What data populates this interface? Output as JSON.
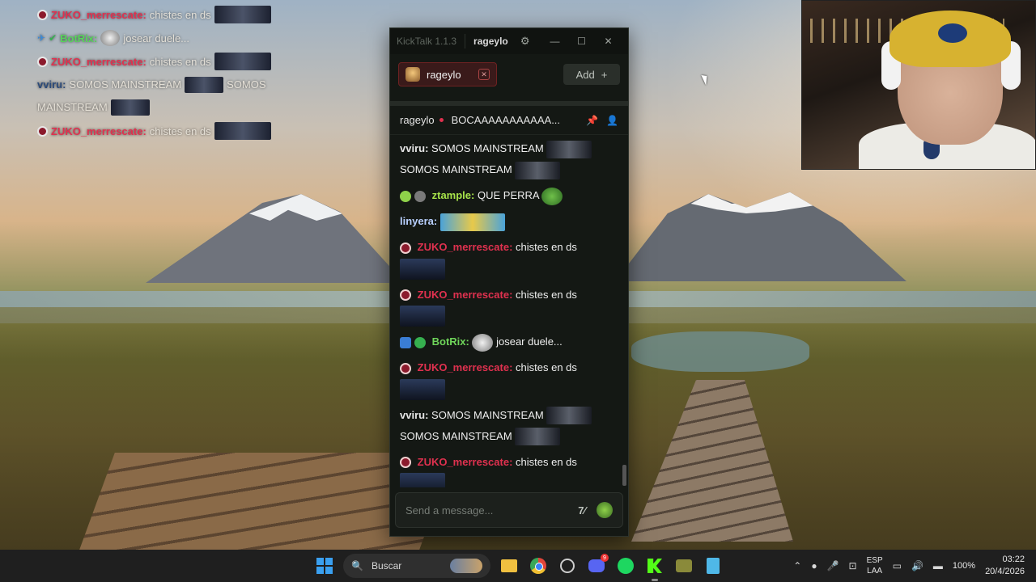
{
  "overlay": {
    "lines": [
      {
        "user": "ZUKO_merrescate:",
        "msg": "chistes en ds"
      },
      {
        "user": "BotRix:",
        "msg": "josear duele..."
      },
      {
        "user": "ZUKO_merrescate:",
        "msg": "chistes en ds"
      },
      {
        "user": "vviru:",
        "msg": "SOMOS MAINSTREAM",
        "msg2": "SOMOS",
        "msg3": "MAINSTREAM"
      },
      {
        "user": "ZUKO_merrescate:",
        "msg": "chistes en ds"
      }
    ]
  },
  "kicktalk": {
    "app_title": "KickTalk 1.1.3",
    "current_user": "rageylo",
    "tab": {
      "label": "rageylo"
    },
    "add_label": "Add",
    "add_icon": "+",
    "channel": "rageylo",
    "stream_title": "BOCAAAAAAAAAAA...",
    "messages": [
      {
        "user": "vviru:",
        "text": "SOMOS MAINSTREAM",
        "text2": "SOMOS MAINSTREAM"
      },
      {
        "user": "ztample:",
        "text": "QUE PERRA"
      },
      {
        "user": "linyera:",
        "text": ""
      },
      {
        "user": "ZUKO_merrescate:",
        "text": "chistes en ds"
      },
      {
        "user": "ZUKO_merrescate:",
        "text": "chistes en ds"
      },
      {
        "user": "BotRix:",
        "text": "josear duele..."
      },
      {
        "user": "ZUKO_merrescate:",
        "text": "chistes en ds"
      },
      {
        "user": "vviru:",
        "text": "SOMOS MAINSTREAM",
        "text2": "SOMOS MAINSTREAM"
      },
      {
        "user": "ZUKO_merrescate:",
        "text": "chistes en ds"
      }
    ],
    "input_placeholder": "Send a message...",
    "translate_icon": "7⁄",
    "colors": {
      "bg": "#141814",
      "tab_border": "#6e2222",
      "user_red": "#e0314f",
      "user_green": "#6fd55a"
    }
  },
  "taskbar": {
    "search_label": "Buscar",
    "discord_badge": "9",
    "lang_line1": "ESP",
    "lang_line2": "LAA",
    "battery": "100%",
    "time": "03:22",
    "date": "20/4/2026"
  },
  "icons": [
    "windows-icon",
    "search-icon",
    "folder-icon",
    "chrome-icon",
    "discord-icon",
    "spotify-icon",
    "kick-icon",
    "notes-icon",
    "gear-icon",
    "close-icon",
    "minimize-icon",
    "maximize-icon"
  ]
}
